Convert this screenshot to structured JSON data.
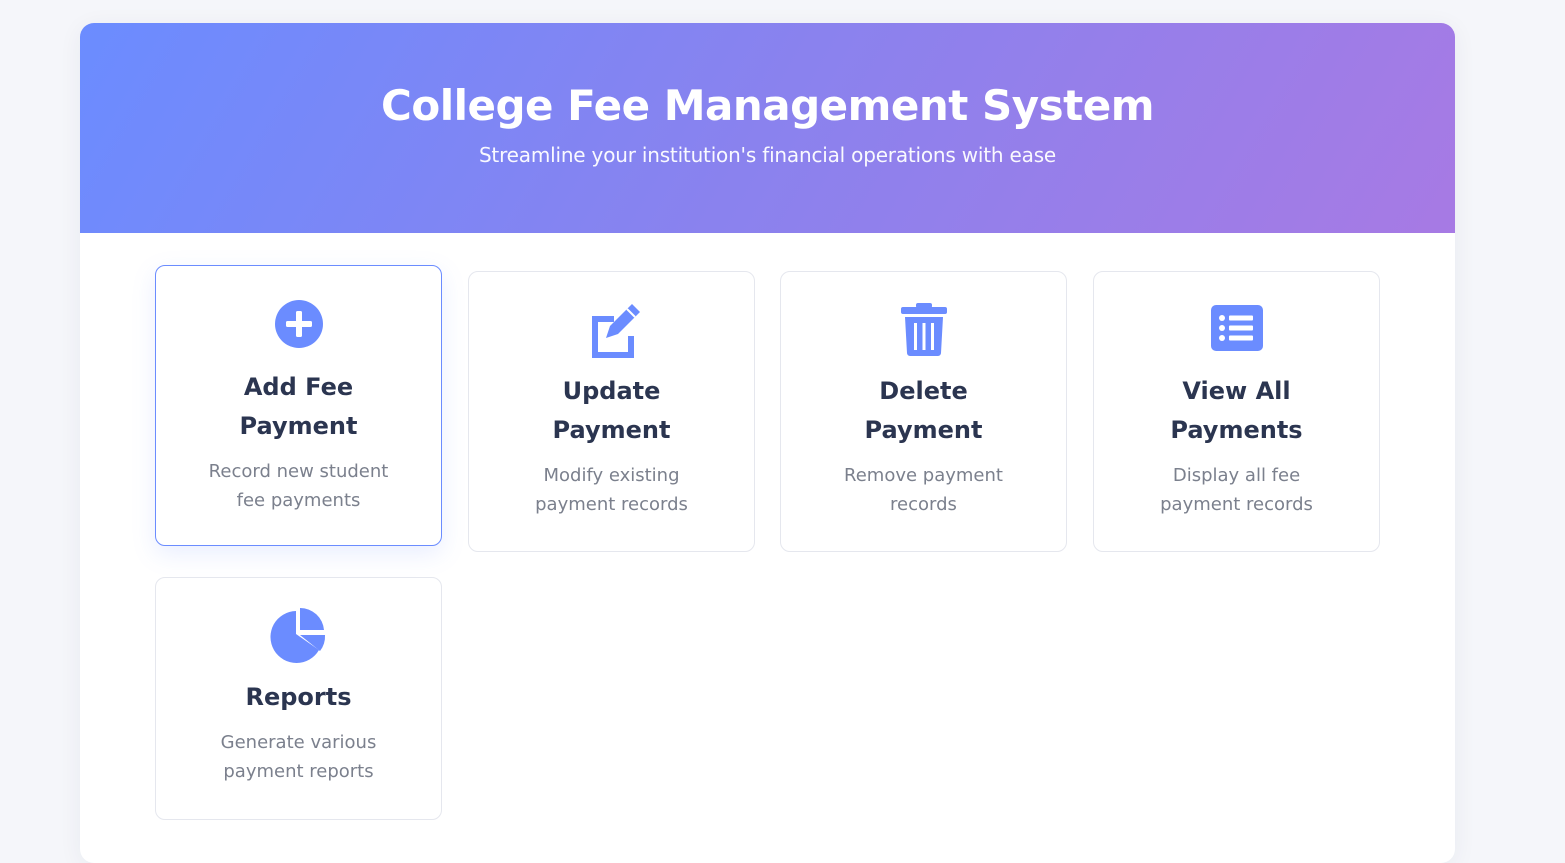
{
  "header": {
    "title": "College Fee Management System",
    "subtitle": "Streamline your institution's financial operations with ease"
  },
  "cards": [
    {
      "title": "Add Fee Payment",
      "description": "Record new student fee payments",
      "icon": "plus-circle-icon"
    },
    {
      "title": "Update Payment",
      "description": "Modify existing payment records",
      "icon": "edit-icon"
    },
    {
      "title": "Delete Payment",
      "description": "Remove payment records",
      "icon": "trash-icon"
    },
    {
      "title": "View All Payments",
      "description": "Display all fee payment records",
      "icon": "list-icon"
    },
    {
      "title": "Reports",
      "description": "Generate various payment reports",
      "icon": "pie-chart-icon"
    }
  ],
  "colors": {
    "accent": "#6b8cff",
    "gradient_start": "#6b8cff",
    "gradient_end": "#a77ae4",
    "heading": "#2b3550",
    "muted": "#7b808d"
  }
}
